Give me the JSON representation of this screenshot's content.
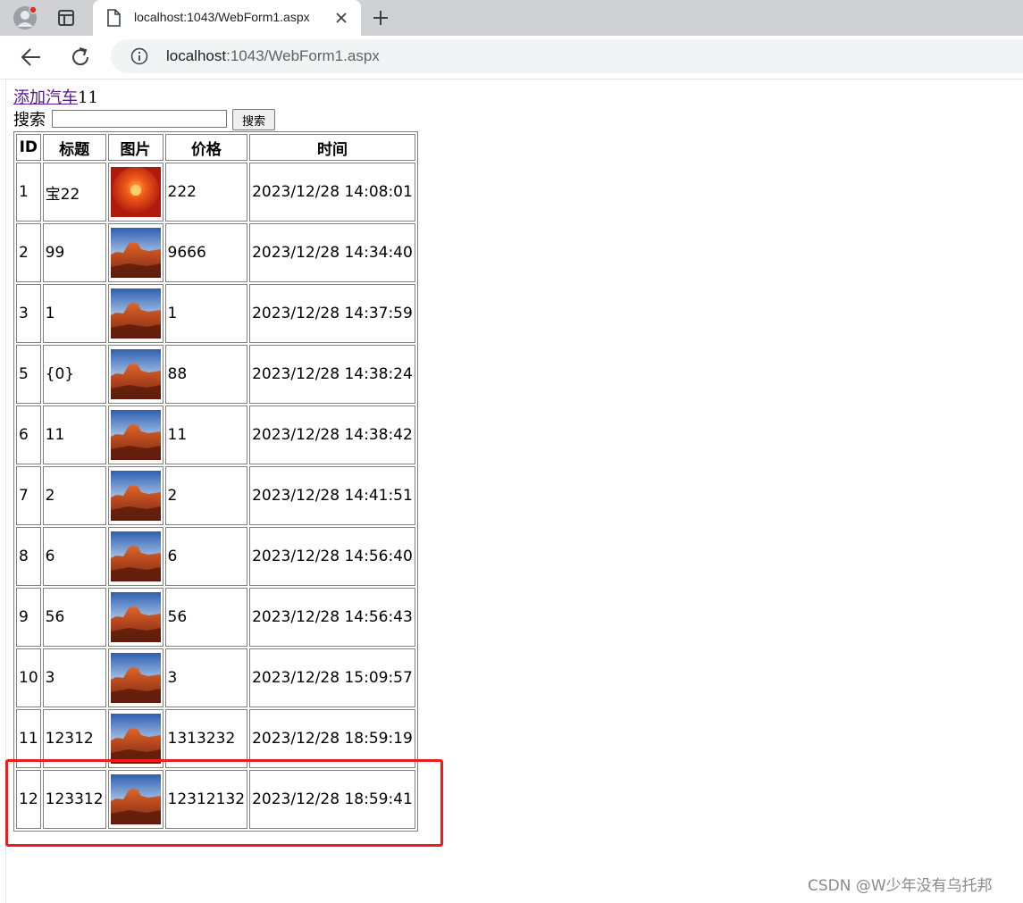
{
  "browser": {
    "tab_title": "localhost:1043/WebForm1.aspx",
    "url_host": "localhost",
    "url_rest": ":1043/WebForm1.aspx"
  },
  "page": {
    "add_link": "添加汽车",
    "add_suffix": "11",
    "search_label": "搜索",
    "search_value": "",
    "search_button": "搜索"
  },
  "table": {
    "headers": [
      "ID",
      "标题",
      "图片",
      "价格",
      "时间"
    ],
    "rows": [
      {
        "id": "1",
        "title": "宝22",
        "image": "flower-thumbnail",
        "price": "222",
        "time": "2023/12/28 14:08:01"
      },
      {
        "id": "2",
        "title": "99",
        "image": "desert-thumbnail",
        "price": "9666",
        "time": "2023/12/28 14:34:40"
      },
      {
        "id": "3",
        "title": "1",
        "image": "desert-thumbnail",
        "price": "1",
        "time": "2023/12/28 14:37:59"
      },
      {
        "id": "5",
        "title": "{0}",
        "image": "desert-thumbnail",
        "price": "88",
        "time": "2023/12/28 14:38:24"
      },
      {
        "id": "6",
        "title": "11",
        "image": "desert-thumbnail",
        "price": "11",
        "time": "2023/12/28 14:38:42"
      },
      {
        "id": "7",
        "title": "2",
        "image": "desert-thumbnail",
        "price": "2",
        "time": "2023/12/28 14:41:51"
      },
      {
        "id": "8",
        "title": "6",
        "image": "desert-thumbnail",
        "price": "6",
        "time": "2023/12/28 14:56:40"
      },
      {
        "id": "9",
        "title": "56",
        "image": "desert-thumbnail",
        "price": "56",
        "time": "2023/12/28 14:56:43"
      },
      {
        "id": "10",
        "title": "3",
        "image": "desert-thumbnail",
        "price": "3",
        "time": "2023/12/28 15:09:57"
      },
      {
        "id": "11",
        "title": "12312",
        "image": "desert-thumbnail",
        "price": "1313232",
        "time": "2023/12/28 18:59:19"
      },
      {
        "id": "12",
        "title": "123312",
        "image": "desert-thumbnail",
        "price": "12312132",
        "time": "2023/12/28 18:59:41"
      }
    ]
  },
  "watermark": "CSDN @W少年没有乌托邦",
  "colors": {
    "tabstrip": "#cfd1d4",
    "link_visited": "#551a8b",
    "highlight": "#ee1c1c",
    "watermark": "#8a8a8a"
  },
  "icons": {
    "profile": "profile-avatar-icon",
    "tab_actions": "tab-actions-icon",
    "tab_page": "page-icon",
    "tab_close": "close-icon",
    "new_tab": "plus-icon",
    "back": "back-arrow-icon",
    "reload": "reload-icon",
    "site_info": "info-icon"
  }
}
